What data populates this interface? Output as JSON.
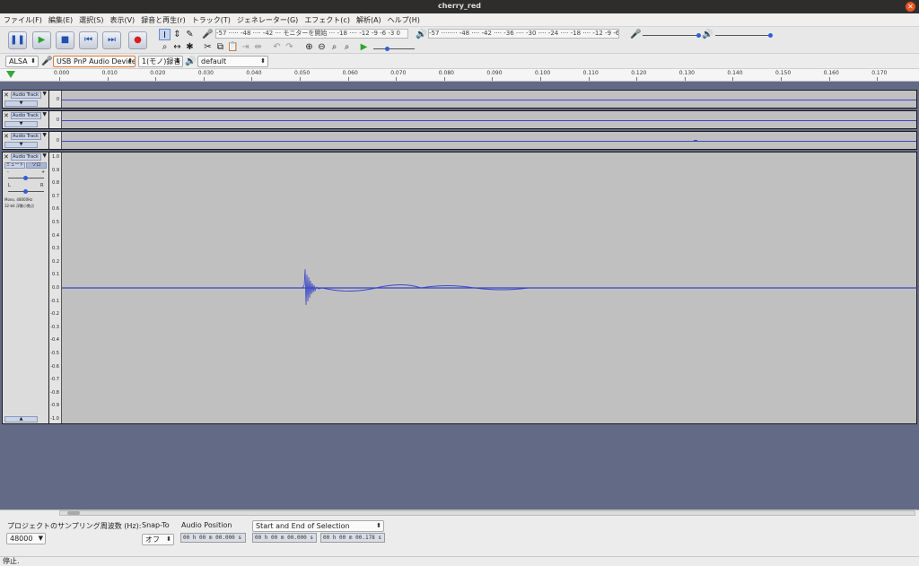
{
  "window": {
    "title": "cherry_red"
  },
  "menu": [
    "ファイル(F)",
    "編集(E)",
    "選択(S)",
    "表示(V)",
    "録音と再生(r)",
    "トラック(T)",
    "ジェネレーター(G)",
    "エフェクト(c)",
    "解析(A)",
    "ヘルプ(H)"
  ],
  "transport": {
    "pause": "❚❚",
    "play": "▶",
    "stop": "■",
    "skip_start": "⏮",
    "skip_end": "⏭",
    "record": "●"
  },
  "rec_meter": {
    "ticks": "-57 ····· -48 ···· -42 ··· モニターを開始 ··· -18 ···· -12 -9 -6 -3 0"
  },
  "play_meter": {
    "ticks": "-57 ········ -48 ···· -42 ···· -36 ···· -30 ···· -24 ···· -18 ···· -12 -9 -6 -3 0"
  },
  "device": {
    "host": "ALSA",
    "input": "USB PnP Audio Device",
    "channels": "1(モノ)録音",
    "output": "default"
  },
  "ruler": {
    "ticks": [
      "0.000",
      "0.010",
      "0.020",
      "0.030",
      "0.040",
      "0.050",
      "0.060",
      "0.070",
      "0.080",
      "0.090",
      "0.100",
      "0.110",
      "0.120",
      "0.130",
      "0.140",
      "0.150",
      "0.160",
      "0.170"
    ]
  },
  "tracks": [
    {
      "name": "Audio Track",
      "scale": [
        "0"
      ]
    },
    {
      "name": "Audio Track",
      "scale": [
        "0"
      ]
    },
    {
      "name": "Audio Track",
      "scale": [
        "0"
      ]
    },
    {
      "name": "Audio Track",
      "mute": "ミュート",
      "solo": "ソロ",
      "gain_minus": "-",
      "gain_plus": "+",
      "pan_left": "L",
      "pan_right": "R",
      "info1": "Mono, 48000Hz",
      "info2": "32-bit 浮動小数点",
      "scale": [
        "1.0",
        "0.9",
        "0.8",
        "0.7",
        "0.6",
        "0.5",
        "0.4",
        "0.3",
        "0.2",
        "0.1",
        "0.0",
        "-0.1",
        "-0.2",
        "-0.3",
        "-0.4",
        "-0.5",
        "-0.6",
        "-0.7",
        "-0.8",
        "-0.9",
        "-1.0"
      ]
    }
  ],
  "bottom": {
    "rate_label": "プロジェクトのサンプリング周波数 (Hz):",
    "rate_value": "48000",
    "snap_label": "Snap-To",
    "snap_value": "オフ",
    "position_label": "Audio Position",
    "position_value": "00 h 00 m 00.000 s",
    "selection_mode": "Start and End of Selection",
    "sel_start": "00 h 00 m 00.000 s",
    "sel_end": "00 h 00 m 00.178 s"
  },
  "status": "停止."
}
